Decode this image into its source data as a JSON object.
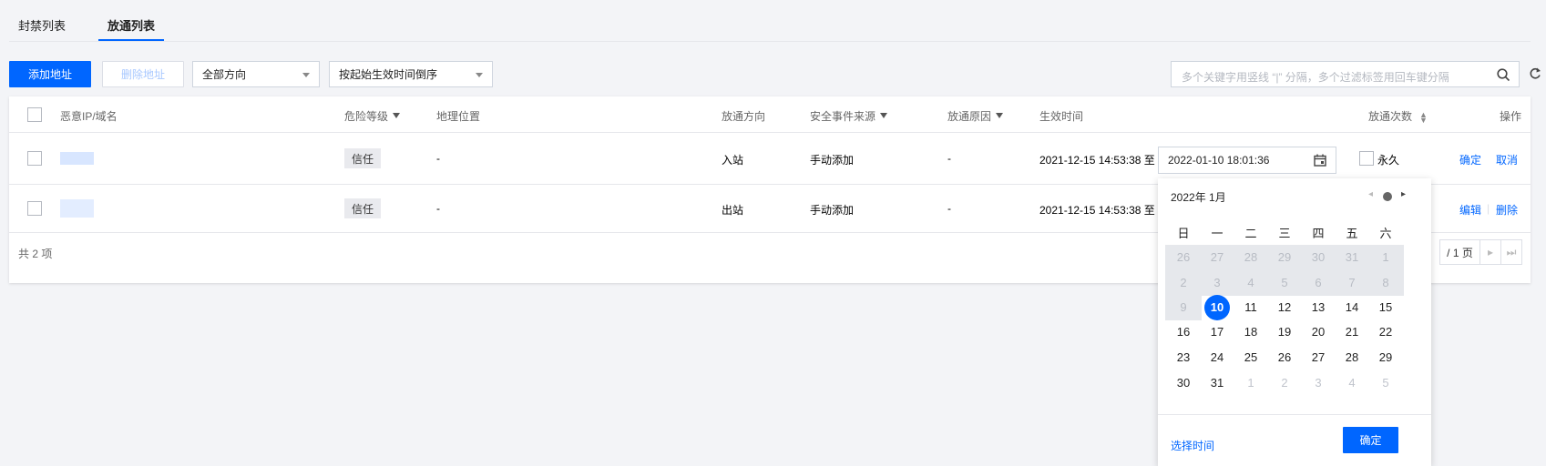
{
  "tabs": [
    {
      "label": "封禁列表"
    },
    {
      "label": "放通列表"
    }
  ],
  "toolbar": {
    "add_label": "添加地址",
    "delete_label": "删除地址",
    "direction_select": "全部方向",
    "sort_select": "按起始生效时间倒序",
    "search_placeholder": "多个关键字用竖线 “|” 分隔，多个过滤标签用回车键分隔"
  },
  "table": {
    "headers": {
      "target": "恶意IP/域名",
      "risk": "危险等级",
      "location": "地理位置",
      "direction": "放通方向",
      "source": "安全事件来源",
      "reason": "放通原因",
      "time": "生效时间",
      "count": "放通次数",
      "actions": "操作"
    },
    "rows": [
      {
        "risk": "信任",
        "location": "-",
        "direction": "入站",
        "source": "手动添加",
        "reason": "-",
        "start": "2021-12-15 14:53:38 至",
        "end": "2022-01-10 18:01:36",
        "forever": "永久",
        "action1": "确定",
        "action2": "取消"
      },
      {
        "risk": "信任",
        "location": "-",
        "direction": "出站",
        "source": "手动添加",
        "reason": "-",
        "start": "2021-12-15 14:53:38 至",
        "action1": "编辑",
        "action2": "删除"
      }
    ],
    "total": "共 2 项",
    "page_total": "/ 1 页"
  },
  "picker": {
    "month_label": "2022年 1月",
    "weekdays": [
      "日",
      "一",
      "二",
      "三",
      "四",
      "五",
      "六"
    ],
    "weeks": [
      [
        "26",
        "27",
        "28",
        "29",
        "30",
        "31",
        "1"
      ],
      [
        "2",
        "3",
        "4",
        "5",
        "6",
        "7",
        "8"
      ],
      [
        "9",
        "10",
        "11",
        "12",
        "13",
        "14",
        "15"
      ],
      [
        "16",
        "17",
        "18",
        "19",
        "20",
        "21",
        "22"
      ],
      [
        "23",
        "24",
        "25",
        "26",
        "27",
        "28",
        "29"
      ],
      [
        "30",
        "31",
        "1",
        "2",
        "3",
        "4",
        "5"
      ]
    ],
    "selected_day": "10",
    "select_time_label": "选择时间",
    "confirm_label": "确定"
  },
  "colors": {
    "accent": "#0066ff"
  }
}
